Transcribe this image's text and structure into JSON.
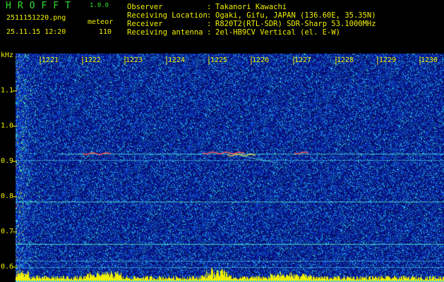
{
  "app": {
    "title": "HROFFT",
    "version": "1.0.0"
  },
  "file": {
    "name": "2511151220.png",
    "datetime": "25.11.15 12:20"
  },
  "meteor": {
    "label": "meteor",
    "count": "110"
  },
  "info": [
    {
      "label": "Observer",
      "value": "Takanori Kawachi"
    },
    {
      "label": "Receiving Location",
      "value": "Ogaki, Gifu, JAPAN (136.60E, 35.35N)"
    },
    {
      "label": "Receiver",
      "value": "R820T2(RTL-SDR) SDR-Sharp 53.1000MHz"
    },
    {
      "label": "Receiving antenna",
      "value": "2el-HB9CV Vertical (el. E-W)"
    }
  ],
  "axes": {
    "y_unit": "kHz",
    "y_ticks": [
      "1.1",
      "1.0",
      "0.9",
      "0.8",
      "0.7",
      "0.6"
    ],
    "x_ticks": [
      "1221",
      "1222",
      "1223",
      "1224",
      "1225",
      "1226",
      "1227",
      "1228",
      "1229",
      "1230"
    ]
  },
  "colors": {
    "text": "#f0f000",
    "title": "#2fe02f",
    "background": "#000000",
    "noise_base": "#0a1a8c"
  }
}
